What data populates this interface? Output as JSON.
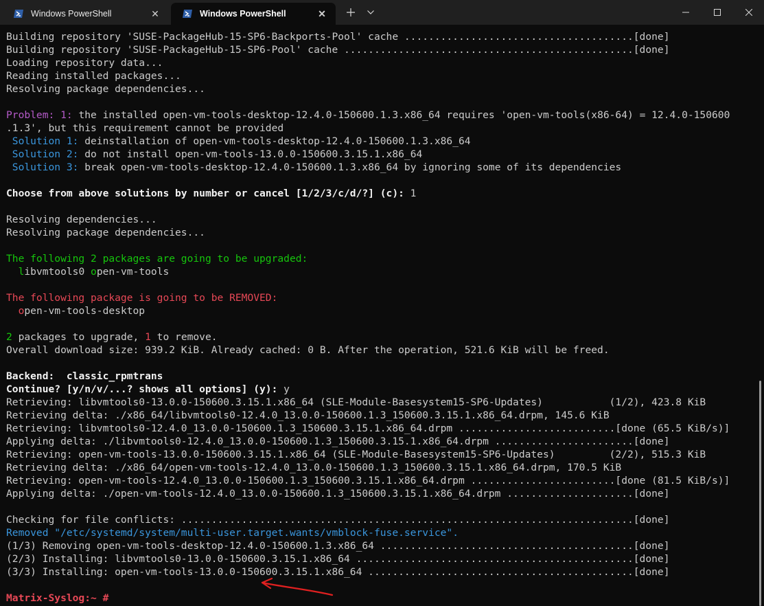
{
  "window": {
    "tabs": [
      {
        "title": "Windows PowerShell",
        "active": false
      },
      {
        "title": "Windows PowerShell",
        "active": true
      }
    ],
    "icons": {
      "new_tab": "plus-icon",
      "dropdown": "chevron-down-icon",
      "minimize": "minimize-icon",
      "maximize": "maximize-icon",
      "close": "close-icon"
    }
  },
  "colors": {
    "background": "#0c0c0c",
    "text": "#cccccc",
    "problem": "#b45ac8",
    "solution": "#3a96dd",
    "upgrade": "#16c60c",
    "removed": "#e74856",
    "annotation_arrow": "#e02020"
  },
  "terminal": {
    "lines": [
      "Building repository 'SUSE-PackageHub-15-SP6-Backports-Pool' cache ......................................[done]",
      "Building repository 'SUSE-PackageHub-15-SP6-Pool' cache ................................................[done]",
      "Loading repository data...",
      "Reading installed packages...",
      "Resolving package dependencies...",
      "",
      "Problem: 1: the installed open-vm-tools-desktop-12.4.0-150600.1.3.x86_64 requires 'open-vm-tools(x86-64) = 12.4.0-150600",
      ".1.3', but this requirement cannot be provided",
      " Solution 1: deinstallation of open-vm-tools-desktop-12.4.0-150600.1.3.x86_64",
      " Solution 2: do not install open-vm-tools-13.0.0-150600.3.15.1.x86_64",
      " Solution 3: break open-vm-tools-desktop-12.4.0-150600.1.3.x86_64 by ignoring some of its dependencies",
      "",
      "Choose from above solutions by number or cancel [1/2/3/c/d/?] (c): 1",
      "",
      "Resolving dependencies...",
      "Resolving package dependencies...",
      "",
      "The following 2 packages are going to be upgraded:",
      "  libvmtools0 open-vm-tools",
      "",
      "The following package is going to be REMOVED:",
      "  open-vm-tools-desktop",
      "",
      "2 packages to upgrade, 1 to remove.",
      "Overall download size: 939.2 KiB. Already cached: 0 B. After the operation, 521.6 KiB will be freed.",
      "",
      "Backend:  classic_rpmtrans",
      "Continue? [y/n/v/...? shows all options] (y): y",
      "Retrieving: libvmtools0-13.0.0-150600.3.15.1.x86_64 (SLE-Module-Basesystem15-SP6-Updates)           (1/2), 423.8 KiB",
      "Retrieving delta: ./x86_64/libvmtools0-12.4.0_13.0.0-150600.1.3_150600.3.15.1.x86_64.drpm, 145.6 KiB",
      "Retrieving: libvmtools0-12.4.0_13.0.0-150600.1.3_150600.3.15.1.x86_64.drpm ..........................[done (65.5 KiB/s)]",
      "Applying delta: ./libvmtools0-12.4.0_13.0.0-150600.1.3_150600.3.15.1.x86_64.drpm .......................[done]",
      "Retrieving: open-vm-tools-13.0.0-150600.3.15.1.x86_64 (SLE-Module-Basesystem15-SP6-Updates)         (2/2), 515.3 KiB",
      "Retrieving delta: ./x86_64/open-vm-tools-12.4.0_13.0.0-150600.1.3_150600.3.15.1.x86_64.drpm, 170.5 KiB",
      "Retrieving: open-vm-tools-12.4.0_13.0.0-150600.1.3_150600.3.15.1.x86_64.drpm ........................[done (81.5 KiB/s)]",
      "Applying delta: ./open-vm-tools-12.4.0_13.0.0-150600.1.3_150600.3.15.1.x86_64.drpm .....................[done]",
      "",
      "Checking for file conflicts: ...........................................................................[done]",
      "Removed \"/etc/systemd/system/multi-user.target.wants/vmblock-fuse.service\".",
      "(1/3) Removing open-vm-tools-desktop-12.4.0-150600.1.3.x86_64 ..........................................[done]",
      "(2/3) Installing: libvmtools0-13.0.0-150600.3.15.1.x86_64 ..............................................[done]",
      "(3/3) Installing: open-vm-tools-13.0.0-150600.3.15.1.x86_64 ............................................[done]",
      "",
      "Matrix-Syslog:~ # "
    ],
    "segments": {
      "problem_label": "Problem:",
      "problem_num": "1:",
      "problem_rest": " the installed open-vm-tools-desktop-12.4.0-150600.1.3.x86_64 requires 'open-vm-tools(x86-64) = 12.4.0-150600",
      "sol1_label": "Solution 1:",
      "sol1_rest": " deinstallation of open-vm-tools-desktop-12.4.0-150600.1.3.x86_64",
      "sol2_label": "Solution 2:",
      "sol2_rest": " do not install open-vm-tools-13.0.0-150600.3.15.1.x86_64",
      "sol3_label": "Solution 3:",
      "sol3_rest": " break open-vm-tools-desktop-12.4.0-150600.1.3.x86_64 by ignoring some of its dependencies",
      "choose_prompt": "Choose from above solutions by number or cancel [1/2/3/c/d/?] (c):",
      "choose_answer": " 1",
      "upgrade_heading": "The following 2 packages are going to be upgraded:",
      "upg_pkg1_first": "l",
      "upg_pkg1_rest": "ibvmtools0 ",
      "upg_pkg2_first": "o",
      "upg_pkg2_rest": "pen-vm-tools",
      "remove_heading": "The following package is going to be REMOVED:",
      "rem_pkg_first": "o",
      "rem_pkg_rest": "pen-vm-tools-desktop",
      "summary_upg_num": "2",
      "summary_mid": " packages to upgrade, ",
      "summary_rem_num": "1",
      "summary_end": " to remove.",
      "backend_label": "Backend:",
      "backend_value": "  classic_rpmtrans",
      "continue_prompt": "Continue? [y/n/v/...? shows all options] (y):",
      "continue_answer": " y",
      "removed_label": "Removed",
      "removed_path": " \"/etc/systemd/system/multi-user.target.wants/vmblock-fuse.service\".",
      "prompt": "Matrix-Syslog:~ #"
    }
  }
}
